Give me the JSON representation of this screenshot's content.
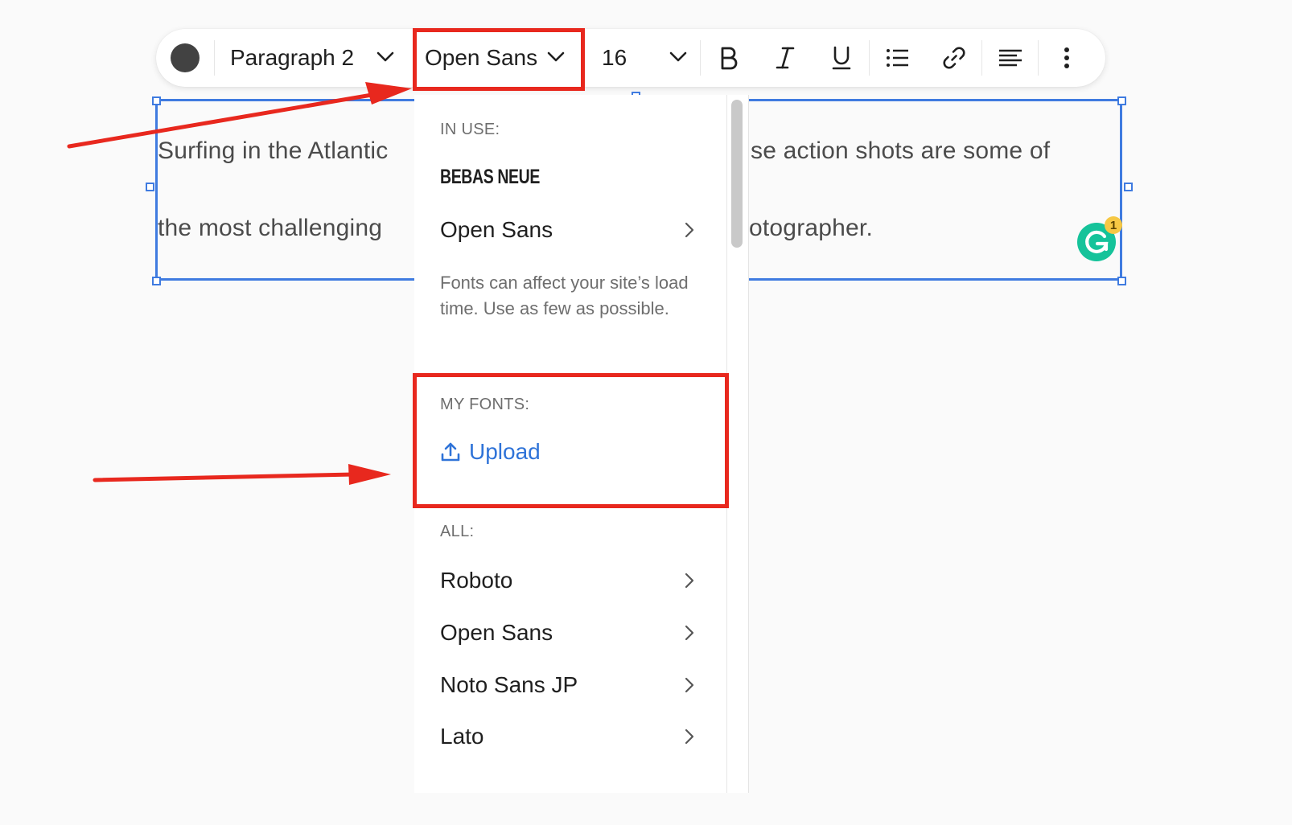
{
  "toolbar": {
    "text_style": "Paragraph 2",
    "font_family": "Open Sans",
    "font_size": "16"
  },
  "text_block": {
    "line1_left": "Surfing in the Atlantic",
    "line1_right": "se action shots are some of",
    "line2_left": "the most challenging",
    "line2_right": "otographer."
  },
  "grammarly": {
    "badge_count": "1"
  },
  "font_menu": {
    "in_use_label": "IN USE:",
    "in_use_fonts": [
      "BEBAS NEUE",
      "Open Sans"
    ],
    "hint": "Fonts can affect your site’s load time. Use as few as possible.",
    "my_fonts_label": "MY FONTS:",
    "upload_label": "Upload",
    "all_label": "ALL:",
    "all_fonts": [
      "Roboto",
      "Open Sans",
      "Noto Sans JP",
      "Lato"
    ]
  },
  "colors": {
    "accent_blue": "#3f7be0",
    "link_blue": "#2f73d8",
    "annotation_red": "#e8281e",
    "grammarly_green": "#15c39a"
  },
  "icons": {
    "bold": "bold-icon",
    "italic": "italic-icon",
    "underline": "underline-icon",
    "list": "bullet-list-icon",
    "link": "link-icon",
    "align": "align-left-icon",
    "more": "more-vertical-icon",
    "upload": "upload-icon"
  }
}
